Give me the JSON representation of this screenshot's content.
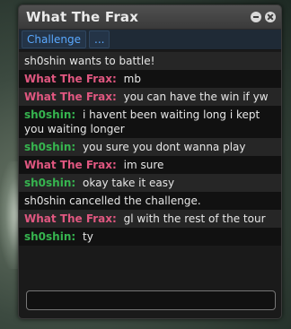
{
  "window": {
    "title": "What The Frax",
    "tabs": [
      "Challenge",
      "..."
    ]
  },
  "messages": [
    {
      "user": "",
      "text": "sh0shin wants to battle!",
      "role": "system"
    },
    {
      "user": "What The Frax:",
      "text": "mb",
      "role": "frax"
    },
    {
      "user": "What The Frax:",
      "text": "you can have the win if yw",
      "role": "frax"
    },
    {
      "user": "sh0shin:",
      "text": "i havent been waiting long i kept you waiting longer",
      "role": "shin"
    },
    {
      "user": "sh0shin:",
      "text": "you sure you dont wanna play",
      "role": "shin"
    },
    {
      "user": "What The Frax:",
      "text": "im sure",
      "role": "frax"
    },
    {
      "user": "sh0shin:",
      "text": "okay take it easy",
      "role": "shin"
    },
    {
      "user": "",
      "text": "sh0shin cancelled the challenge.",
      "role": "system"
    },
    {
      "user": "What The Frax:",
      "text": "gl with the rest of the tour",
      "role": "frax"
    },
    {
      "user": "sh0shin:",
      "text": "ty",
      "role": "shin"
    }
  ],
  "input": {
    "value": ""
  },
  "colors": {
    "frax": "#e05780",
    "shin": "#36b54f",
    "tab": "#5aa9ff"
  }
}
